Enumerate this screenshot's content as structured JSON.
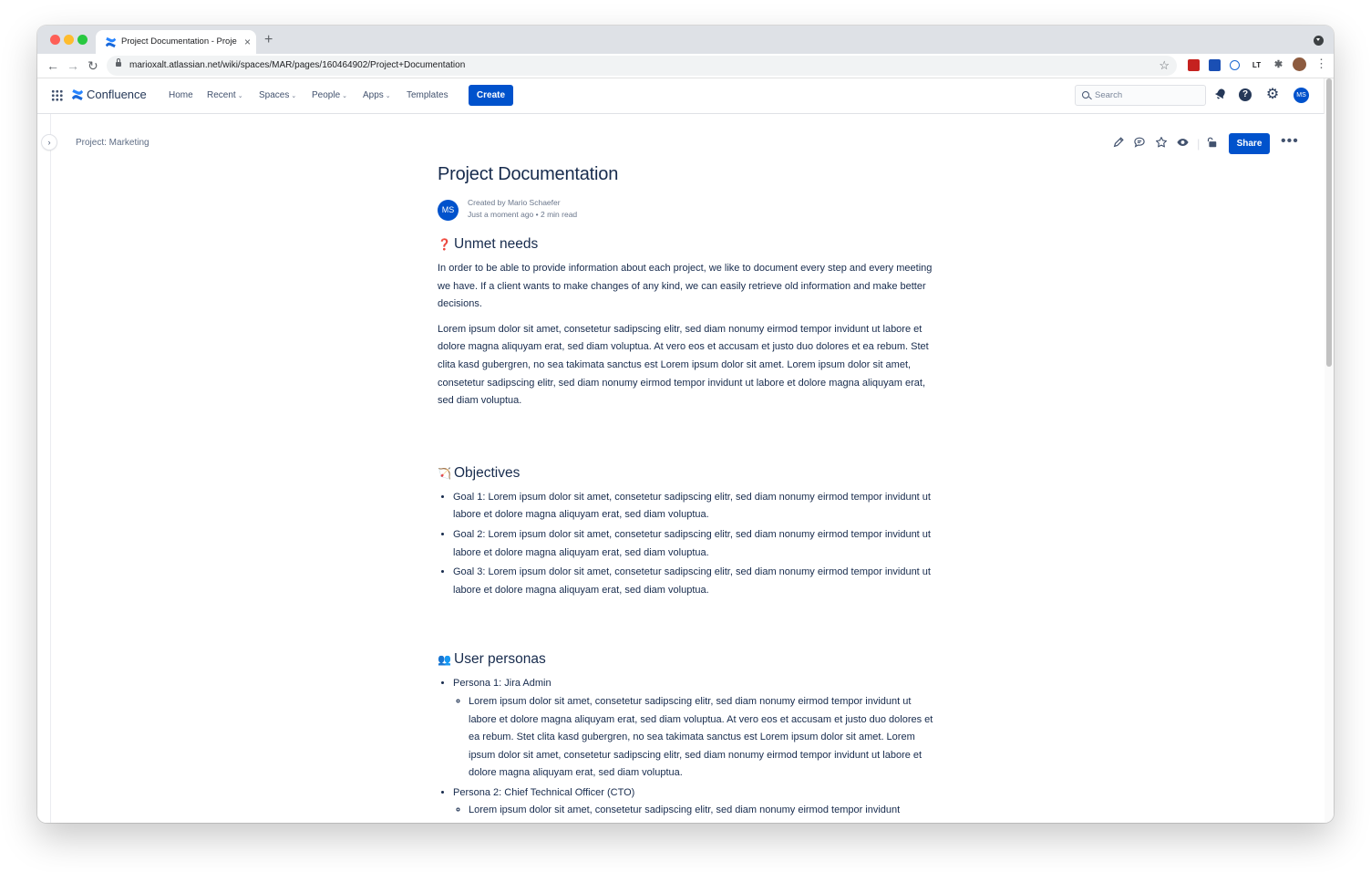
{
  "browser": {
    "tab_title": "Project Documentation - Proje",
    "tab_close": "×",
    "new_tab": "+",
    "url": "marioxalt.atlassian.net/wiki/spaces/MAR/pages/160464902/Project+Documentation",
    "back": "←",
    "forward": "→",
    "reload": "↻",
    "star": "☆",
    "menu": "⋮"
  },
  "header": {
    "product": "Confluence",
    "nav": {
      "home": "Home",
      "recent": "Recent",
      "spaces": "Spaces",
      "people": "People",
      "apps": "Apps",
      "templates": "Templates"
    },
    "create": "Create",
    "search_placeholder": "Search",
    "help": "?",
    "avatar_initials": "MS"
  },
  "page": {
    "breadcrumb": "Project: Marketing",
    "share": "Share",
    "more": "•••",
    "title": "Project Documentation",
    "byline": {
      "initials": "MS",
      "created_by": "Created by Mario Schaefer",
      "time": "Just a moment ago",
      "read_time": "2 min read"
    },
    "sections": {
      "unmet": {
        "heading": "Unmet needs",
        "emoji": "❓",
        "p1": "In order to be able to provide information about each project, we like to document every step and every meeting we have. If a client wants to make changes of any kind, we can easily retrieve old information and make better decisions.",
        "p2": "Lorem ipsum dolor sit amet, consetetur sadipscing elitr, sed diam nonumy eirmod tempor invidunt ut labore et dolore magna aliquyam erat, sed diam voluptua. At vero eos et accusam et justo duo dolores et ea rebum. Stet clita kasd gubergren, no sea takimata sanctus est Lorem ipsum dolor sit amet. Lorem ipsum dolor sit amet, consetetur sadipscing elitr, sed diam nonumy eirmod tempor invidunt ut labore et dolore magna aliquyam erat, sed diam voluptua."
      },
      "objectives": {
        "heading": "Objectives",
        "emoji": "🏹",
        "goals": [
          "Goal 1: Lorem ipsum dolor sit amet, consetetur sadipscing elitr, sed diam nonumy eirmod tempor invidunt ut labore et dolore magna aliquyam erat, sed diam voluptua.",
          "Goal 2: Lorem ipsum dolor sit amet, consetetur sadipscing elitr, sed diam nonumy eirmod tempor invidunt ut labore et dolore magna aliquyam erat, sed diam voluptua.",
          "Goal 3: Lorem ipsum dolor sit amet, consetetur sadipscing elitr, sed diam nonumy eirmod tempor invidunt ut labore et dolore magna aliquyam erat, sed diam voluptua."
        ]
      },
      "personas": {
        "heading": "User personas",
        "emoji": "👥",
        "items": [
          {
            "label": "Persona 1: Jira Admin",
            "detail": "Lorem ipsum dolor sit amet, consetetur sadipscing elitr, sed diam nonumy eirmod tempor invidunt ut labore et dolore magna aliquyam erat, sed diam voluptua. At vero eos et accusam et justo duo dolores et ea rebum. Stet clita kasd gubergren, no sea takimata sanctus est Lorem ipsum dolor sit amet. Lorem ipsum dolor sit amet, consetetur sadipscing elitr, sed diam nonumy eirmod tempor invidunt ut labore et dolore magna aliquyam erat, sed diam voluptua."
          },
          {
            "label": "Persona 2: Chief Technical Officer (CTO)",
            "detail": "Lorem ipsum dolor sit amet, consetetur sadipscing elitr, sed diam nonumy eirmod tempor invidunt"
          }
        ]
      }
    }
  },
  "colors": {
    "brand": "#0052cc",
    "text": "#172b4d",
    "subtle": "#6b778c"
  },
  "icons": {
    "app_switcher": "grid-icon",
    "logo": "confluence-logo-icon",
    "notifications": "bell-icon",
    "help": "help-icon",
    "settings": "gear-icon",
    "edit": "pencil-icon",
    "comment": "comment-icon",
    "star": "star-icon",
    "watch": "eye-icon",
    "restrictions": "lock-icon"
  }
}
